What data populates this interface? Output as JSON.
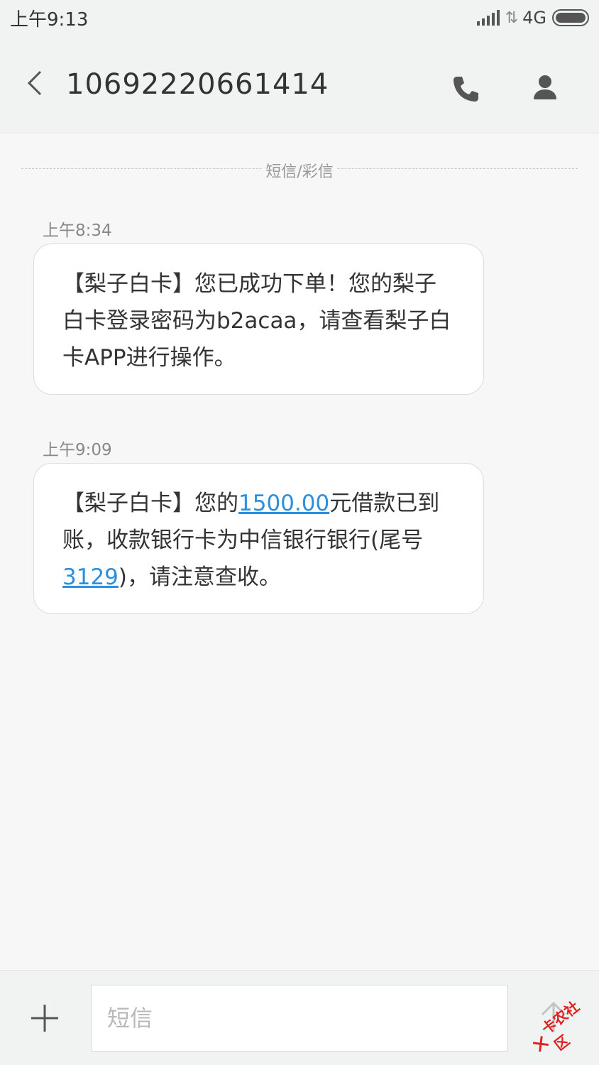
{
  "status_bar": {
    "time": "上午9:13",
    "network": "4G",
    "icons": [
      "signal-icon",
      "data-arrows-icon",
      "battery-icon"
    ]
  },
  "header": {
    "title": "10692220661414",
    "icons": [
      "back-chevron-icon",
      "phone-icon",
      "contact-person-icon"
    ]
  },
  "divider_label": "短信/彩信",
  "messages": [
    {
      "time": "上午8:34",
      "text": "【梨子白卡】您已成功下单！您的梨子白卡登录密码为b2acaa，请查看梨子白卡APP进行操作。"
    },
    {
      "time": "上午9:09",
      "text_before_amount": "【梨子白卡】您的",
      "amount": "1500.00",
      "text_after_amount": "元借款已到账，收款银行卡为中信银行银行(尾号",
      "card_tail": "3129",
      "text_end": ")，请注意查收。"
    }
  ],
  "input": {
    "placeholder": "短信"
  },
  "bottom_icons": [
    "plus-icon",
    "send-arrow-icon"
  ],
  "watermark": {
    "text": "卡农社区"
  },
  "colors": {
    "link": "#2b8fdd",
    "background": "#f7f7f7",
    "bar": "#f1f2f2",
    "watermark": "#e02020"
  }
}
